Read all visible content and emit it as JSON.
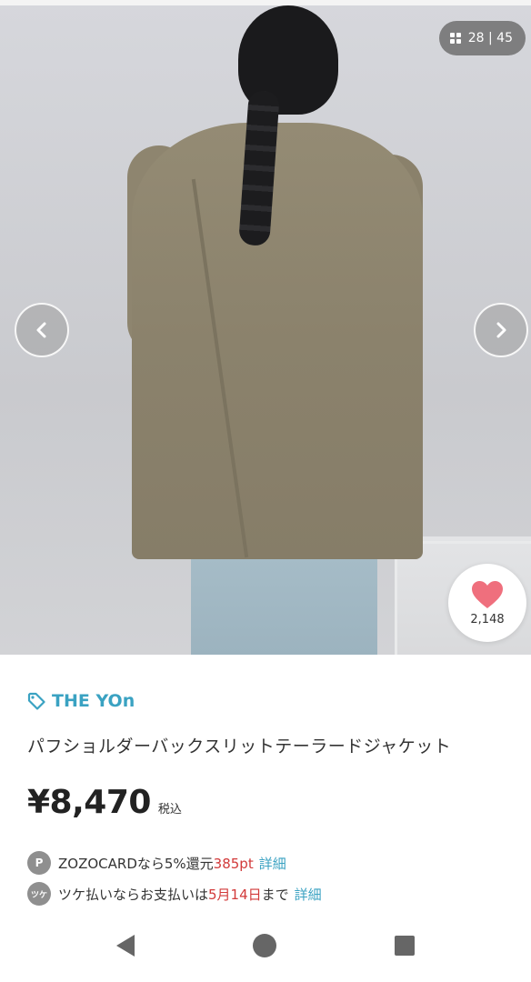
{
  "gallery": {
    "counter_text": "28 | 45",
    "icons": {
      "grid": "grid-view-icon",
      "prev": "chevron-left-icon",
      "next": "chevron-right-icon"
    }
  },
  "like": {
    "icon": "heart-icon",
    "count": "2,148",
    "color": "#ef6f7d"
  },
  "product": {
    "brand": "THE YOn",
    "brand_icon": "tag-icon",
    "brand_color": "#3aa2c2",
    "title": "パフショルダーバックスリットテーラードジャケット",
    "price": "¥8,470",
    "tax_label": "税込"
  },
  "points": {
    "badge": "P",
    "text_prefix": "ZOZOCARDなら5%還元",
    "points_value": "385pt",
    "link": "詳細"
  },
  "tsuke": {
    "badge": "ツケ",
    "text_prefix": "ツケ払いならお支払いは",
    "date": "5月14日",
    "text_suffix": "まで",
    "link": "詳細"
  },
  "system_nav": {
    "back": "back-icon",
    "home": "home-icon",
    "recents": "recents-icon"
  }
}
